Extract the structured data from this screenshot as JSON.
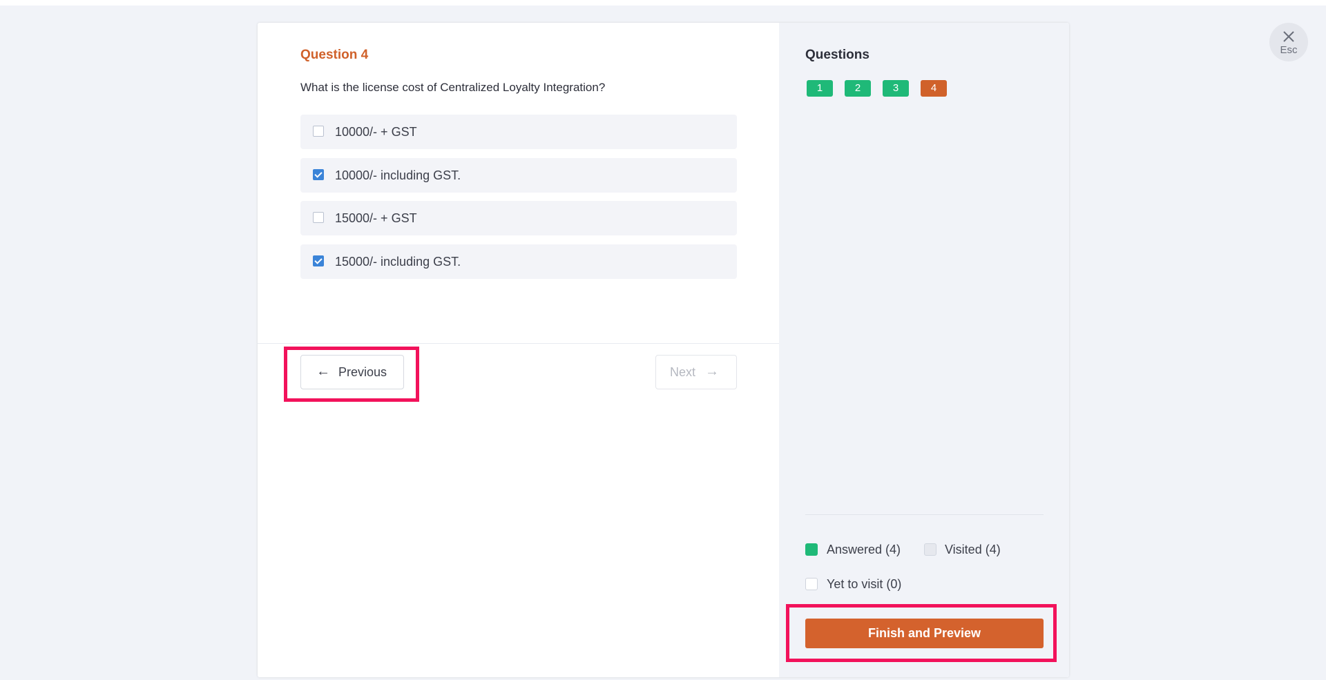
{
  "question": {
    "heading": "Question 4",
    "text": "What is the license cost of Centralized Loyalty Integration?",
    "options": [
      {
        "label": "10000/- + GST",
        "checked": false
      },
      {
        "label": "10000/- including GST.",
        "checked": true
      },
      {
        "label": "15000/- + GST",
        "checked": false
      },
      {
        "label": "15000/- including GST.",
        "checked": true
      }
    ]
  },
  "navigation": {
    "previous_label": "Previous",
    "next_label": "Next",
    "previous_icon": "arrow-left-icon",
    "next_icon": "arrow-right-icon"
  },
  "sidebar": {
    "title": "Questions",
    "question_numbers": [
      {
        "number": "1",
        "status": "answered"
      },
      {
        "number": "2",
        "status": "answered"
      },
      {
        "number": "3",
        "status": "answered"
      },
      {
        "number": "4",
        "status": "current"
      }
    ],
    "legend": {
      "answered": "Answered (4)",
      "visited": "Visited (4)",
      "yet_to_visit": "Yet to visit (0)"
    },
    "finish_label": "Finish and Preview"
  },
  "close": {
    "label": "Esc",
    "icon": "close-icon"
  },
  "colors": {
    "accent_orange": "#d0612a",
    "answered_green": "#1fb978",
    "checkbox_blue": "#3b84d8",
    "highlight_pink": "#f2125b"
  }
}
